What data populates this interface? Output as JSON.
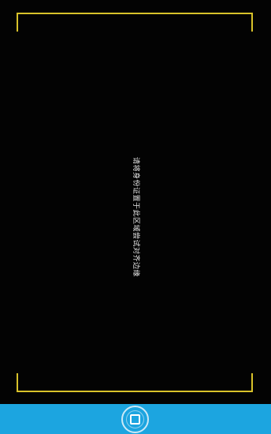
{
  "scan_hint": "请将身份证置于此区域尝试对齐边缘",
  "frame_color": "#d8c22a",
  "bottom_bar_color": "#1ca5e0",
  "shutter": {
    "icon": "square-capture-icon"
  }
}
